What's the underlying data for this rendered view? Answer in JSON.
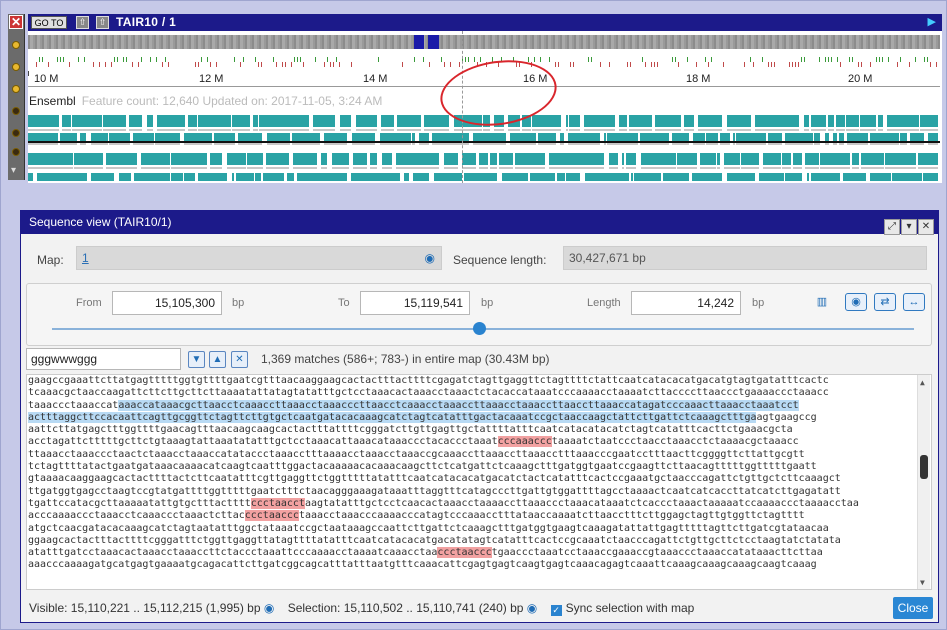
{
  "top": {
    "goto_label": "GO TO",
    "map_title": "TAIR10 / 1",
    "scale_labels": [
      "10 M",
      "12 M",
      "14 M",
      "16 M",
      "18 M",
      "20 M"
    ],
    "track_name": "Ensembl",
    "track_meta": "Feature count: 12,640  Updated on: 2017-11-05, 3:24 AM"
  },
  "dialog": {
    "title": "Sequence view (TAIR10/1)",
    "map_label": "Map:",
    "map_value": "1",
    "seq_length_label": "Sequence length:",
    "seq_length_value": "30,427,671 bp",
    "from_label": "From",
    "from_value": "15,105,300",
    "to_label": "To",
    "to_value": "15,119,541",
    "length_label": "Length",
    "length_value": "14,242",
    "unit": "bp",
    "search_value": "gggwwwggg",
    "matches_text": "1,369 matches (586+; 783-) in entire map (30.43M bp)",
    "visible_text": "Visible: 15,110,221 .. 15,112,215 (1,995) bp",
    "selection_text": "Selection: 15,110,502 .. 15,110,741 (240) bp",
    "sync_label": "Sync selection with map",
    "close_label": "Close"
  },
  "sequence_lines": [
    [
      {
        "t": "gaagccgaaattcttatgagtttttggtgttttgaatcgtttaacaaggaagcactactttacttttcgagatctagttgaggttctagttttctattcaatcatacacatgacatgtagtgatatttcactc"
      }
    ],
    [
      {
        "t": "tcaaacgctaaccaagattcttcttgcttcttaaaatattatagtatatttgctcctaaacactaaacctaaactctacaccataaatcccaaaacctaaaatcttaccccttaaccctgaaaaccctaaacc"
      }
    ],
    [
      {
        "t": "taaaccctaaaccat"
      },
      {
        "t": "aaaccataaacgcttaacctcaaaccttaaacctaaacccttaacctcaaacctaaaccttaaacctaaaccttaaccttaaaccatagatcccaaacttaaacctaaatcct",
        "c": "hl"
      }
    ],
    [
      {
        "t": "actttaggcttccacaattcagttgcggttctagttcttgtgctcaatgatacacaaagcatctagtcatatttgactacaaatccgctaaccaagctattcttgattctcaaagctttga",
        "c": "hl"
      },
      {
        "t": "agtgaagccg"
      }
    ],
    [
      {
        "t": "aattcttatgagctttggttttgaacagtttaacaagcaagcactactttattttcgggatcttgttgagttgctattttatttcaatcatacatacatctagtcatatttcacttctgaaacgcta"
      }
    ],
    [
      {
        "t": "acctagattctttttgcttctgtaaagtattaaatatatttgctcctaaacattaaacataaaccctacaccctaaat"
      },
      {
        "t": "cccaaaccc",
        "c": "pk"
      },
      {
        "t": "taaaatctaatccctaacctaaacctctaaaacgctaaacc"
      }
    ],
    [
      {
        "t": "ttaaacctaaaccctaactctaaacctaaaccatataccctaaacctttaaaacctaaacctaaaccgcaaaccttaaaccttaaacctttaaacccgaatcctttaacttcggggttcttattgcgtt"
      }
    ],
    [
      {
        "t": "tctagttttatactgaatgataaacaaaacatcaagtcaatttggactacaaaaacacaaacaagcttctcatgattctcaaagctttgatggtgaatccgaagttcttaacagtttttggtttttgaatt"
      }
    ],
    [
      {
        "t": "gtaaaacaaggaagcactacttttactcttcaatatttcgttgaggttctggtttttatatttcaatcatacacatgacatctactcatatttcactccgaaatgctaacccagattctgttgctcttcaaagct"
      }
    ],
    [
      {
        "t": "ttgatggtgagcctaagtccgtatgattttggtttttgaatctttctaacagggaaagataaatttaggtttcatagcccttgattgtggattttagcctaaaactcaatcatcaccttatcatcttgagatatt"
      }
    ],
    [
      {
        "t": "tgattccatacgcttaaaaatattgtgctttactttt"
      },
      {
        "t": "ccctaacct",
        "c": "pk"
      },
      {
        "t": "aagtatatttgctcctcaacactaaacctaaaaccttaaaccctaaacataaatctcaccctaaactaaaaatccaaaaccctaaaacctaa"
      }
    ],
    [
      {
        "t": "acccaaaaccctaaacctcaaaccctaaactcttac"
      },
      {
        "t": "ccctaaccc",
        "c": "pk"
      },
      {
        "t": "taaacctaaacccaaaacccatagtcccaaacctttataaccaaaatcttaacctttcttggagctagttgtggttctagtttt"
      }
    ],
    [
      {
        "t": "atgctcaacgatacacaaagcatctagtaatatttggctataaatccgctaataaagccaattcttgattctcaaagctttgatggtgaagtcaaagatattattgagtttttagttcttgatcgtataacaa"
      }
    ],
    [
      {
        "t": "ggaagcactactttacttttcgggatttctggttgaggttatagttttatatttcaatcatacacatgacatatagtcatatttcactccgcaaatctaacccagattctgttgcttctcctaagtatctatata"
      }
    ],
    [
      {
        "t": "atatttgatcctaaacactaaacctaaaccttctaccctaaattcccaaaacctaaaatcaaacctaa"
      },
      {
        "t": "ccctaaccc",
        "c": "pk"
      },
      {
        "t": "tgaaccctaaatcctaaaccgaaaccgtaaaccctaaaccatataaacttcttaa"
      }
    ],
    [
      {
        "t": "aaacccaaaagatgcatgagtgaaaatgcagacattcttgatcggcagcatttatttaatgtttcaaacattcgagtgagtcaagtgagtcaaacagagtcaaattcaaagcaaagcaaagcaagtcaaag"
      }
    ]
  ]
}
